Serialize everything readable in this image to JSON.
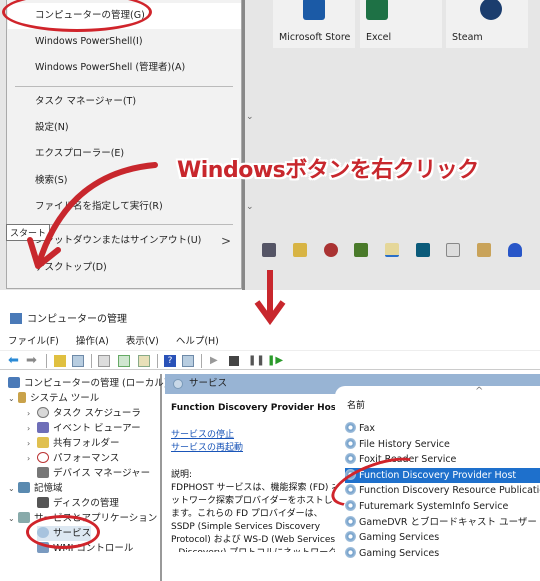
{
  "context_menu": {
    "items": [
      {
        "label": "コンピューターの管理(G)",
        "highlighted": true
      },
      {
        "label": "Windows PowerShell(I)"
      },
      {
        "label": "Windows PowerShell (管理者)(A)"
      },
      {
        "label": "タスク マネージャー(T)"
      },
      {
        "label": "設定(N)"
      },
      {
        "label": "エクスプローラー(E)"
      },
      {
        "label": "検索(S)"
      },
      {
        "label": "ファイル名を指定して実行(R)"
      },
      {
        "label": "シャットダウンまたはサインアウト(U)",
        "submenu": true
      },
      {
        "label": "デスクトップ(D)"
      }
    ],
    "submenu_chevron": ">"
  },
  "start_tiles": [
    {
      "label": "Microsoft Store",
      "icon": "microsoft-store-icon",
      "color": "#1b5aa6"
    },
    {
      "label": "Excel",
      "icon": "excel-icon",
      "color": "#1e7145"
    },
    {
      "label": "Steam",
      "icon": "steam-icon",
      "color": "#1b3d6e"
    }
  ],
  "tooltip": "スタート",
  "annotation": {
    "text": "Windowsボタンを右クリック",
    "color": "#c8272d"
  },
  "taskbar_icons": [
    "app-icon-1",
    "app-icon-2",
    "app-icon-3",
    "app-icon-4",
    "app-icon-5",
    "app-icon-6",
    "app-icon-7",
    "app-icon-8",
    "headset-icon"
  ],
  "mmc": {
    "title": "コンピューターの管理",
    "menubar": [
      "ファイル(F)",
      "操作(A)",
      "表示(V)",
      "ヘルプ(H)"
    ],
    "tree": [
      {
        "label": "コンピューターの管理 (ローカル)",
        "level": 0
      },
      {
        "label": "システム ツール",
        "level": 1,
        "expanded": true
      },
      {
        "label": "タスク スケジューラ",
        "level": 2,
        "collapsed": true
      },
      {
        "label": "イベント ビューアー",
        "level": 2,
        "collapsed": true
      },
      {
        "label": "共有フォルダー",
        "level": 2,
        "collapsed": true
      },
      {
        "label": "パフォーマンス",
        "level": 2,
        "collapsed": true
      },
      {
        "label": "デバイス マネージャー",
        "level": 2
      },
      {
        "label": "記憶域",
        "level": 1,
        "expanded": true
      },
      {
        "label": "ディスクの管理",
        "level": 2
      },
      {
        "label": "サービスとアプリケーション",
        "level": 1,
        "expanded": true
      },
      {
        "label": "サービス",
        "level": 2,
        "selected": true
      },
      {
        "label": "WMI コントロール",
        "level": 2
      }
    ],
    "services_header": "サービス",
    "detail": {
      "service_name": "Function Discovery Provider Host",
      "links": [
        "サービスの停止",
        "サービスの再起動"
      ],
      "desc_label": "説明:",
      "description": "FDPHOST サービスは、機能探索 (FD) ネットワーク探索プロバイダーをホストします。これらの FD プロバイダーは、SSDP (Simple Services Discovery Protocol) および WS-D (Web Services – Discovery) プロトコルにネットワーク探索サービスを提供します"
    },
    "list": {
      "column": "名前",
      "sort_indicator": "^",
      "rows": [
        {
          "name": "Fax"
        },
        {
          "name": "File History Service"
        },
        {
          "name": "Foxit Reader Service"
        },
        {
          "name": "Function Discovery Provider Host",
          "selected": true
        },
        {
          "name": "Function Discovery Resource Publication"
        },
        {
          "name": "Futuremark SystemInfo Service"
        },
        {
          "name": "GameDVR とブロードキャスト ユーザー サービス_c"
        },
        {
          "name": "Gaming Services"
        },
        {
          "name": "Gaming Services"
        }
      ]
    }
  }
}
